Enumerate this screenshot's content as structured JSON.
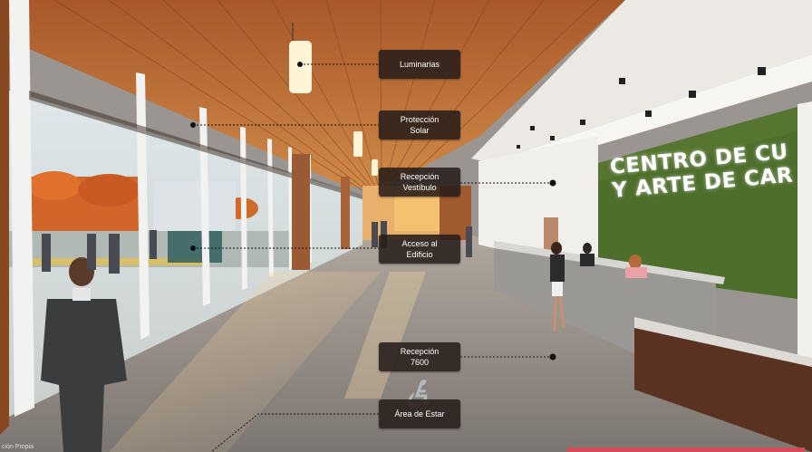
{
  "labels": {
    "luminarias": "Luminarias",
    "proteccion_1": "Protección",
    "proteccion_2": "Solar",
    "recepcion_vestibulo_1": "Recepción",
    "recepcion_vestibulo_2": "Vestíbulo",
    "acceso_1": "Acceso al",
    "acceso_2": "Edificio",
    "recepcion_area_1": "Recepción",
    "recepcion_area_2": "7600",
    "area_estar": "Área de Estar"
  },
  "wall_sign": {
    "line1": "CENTRO DE CU",
    "line2": "Y ARTE DE CAR"
  },
  "watermark": "ción Propia",
  "colors": {
    "ceiling_wood": "#b86a30",
    "label_bg": "#2a1e1a",
    "green_wall": "#4a6b2a",
    "floor": "#8c8682"
  }
}
